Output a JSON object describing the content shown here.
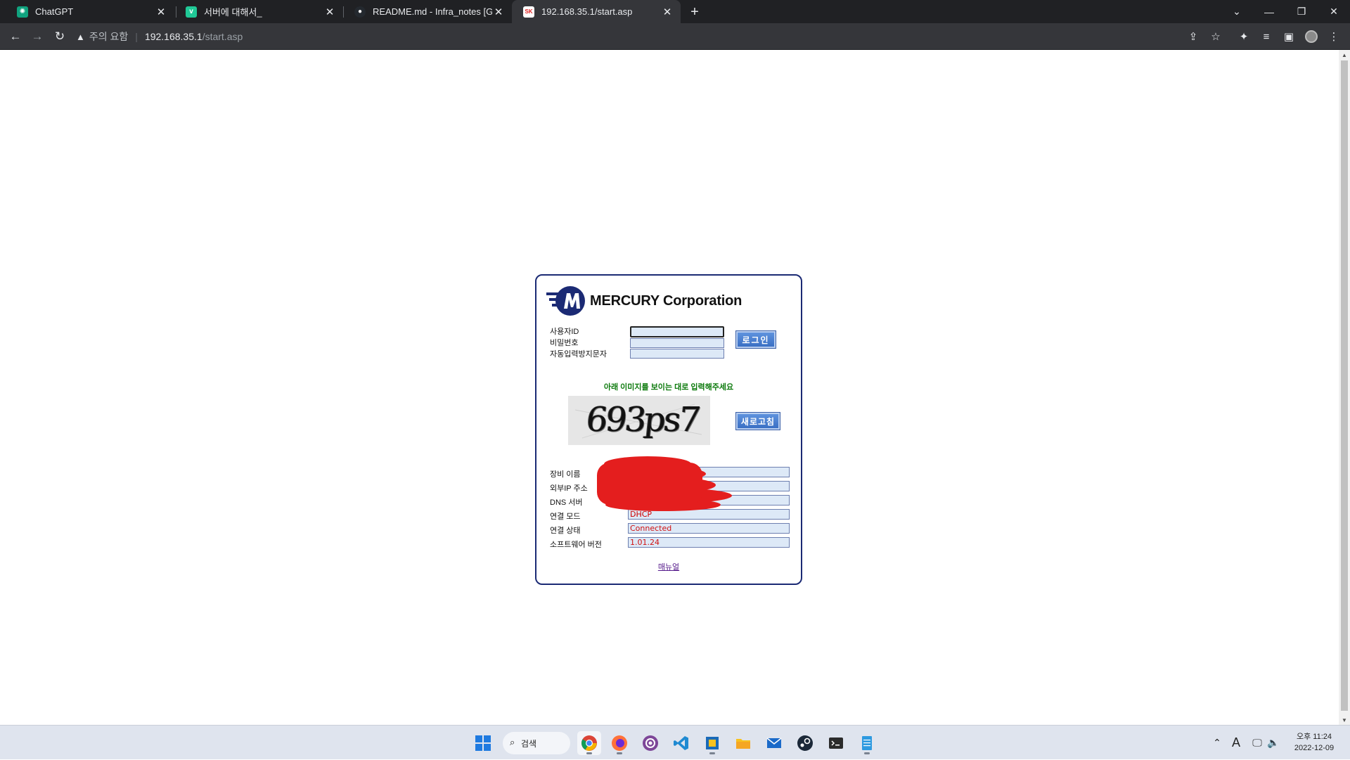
{
  "browser": {
    "tabs": [
      {
        "title": "ChatGPT",
        "favicon": "chatgpt-icon",
        "favicon_color": "#10a37f"
      },
      {
        "title": "서버에 대해서_",
        "favicon": "velog-icon",
        "favicon_color": "#20c997"
      },
      {
        "title": "README.md - Infra_notes [GitHub]",
        "favicon": "github-icon",
        "favicon_color": "#24292f"
      },
      {
        "title": "192.168.35.1/start.asp",
        "favicon": "sk-icon",
        "favicon_color": "#e02020"
      }
    ],
    "active_tab": 3,
    "address": {
      "security_label": "주의 요함",
      "host": "192.168.35.1",
      "path": "/start.asp"
    }
  },
  "login": {
    "brand": "MERCURY Corporation",
    "fields": {
      "user_id_label": "사용자ID",
      "password_label": "비밀번호",
      "captcha_label": "자동입력방지문자",
      "user_id_value": "",
      "password_value": "",
      "captcha_value": ""
    },
    "login_button": "로그인",
    "hint": "아래 이미지를 보이는 대로 입력해주세요",
    "captcha_text": "693ps7",
    "refresh_button": "새로고침",
    "info": [
      {
        "label": "장비 이름",
        "value": ""
      },
      {
        "label": "외부IP 주소",
        "value": ""
      },
      {
        "label": "DNS 서버",
        "value": ""
      },
      {
        "label": "연결 모드",
        "value": "DHCP"
      },
      {
        "label": "연결 상태",
        "value": "Connected"
      },
      {
        "label": "소프트웨어 버전",
        "value": "1.01.24"
      }
    ],
    "manual_link": "매뉴얼",
    "brand_color": "#1b2a74",
    "redaction_color": "#e41e1e"
  },
  "taskbar": {
    "search_label": "검색",
    "apps": [
      "windows-start-icon",
      "search",
      "chrome-icon",
      "firefox-icon",
      "tor-browser-icon",
      "vscode-icon",
      "virtualbox-icon",
      "file-explorer-icon",
      "mail-icon",
      "steam-icon",
      "terminal-icon",
      "notepad-icon"
    ],
    "tray": {
      "ime": "A",
      "time": "오후 11:24",
      "date": "2022-12-09"
    }
  }
}
